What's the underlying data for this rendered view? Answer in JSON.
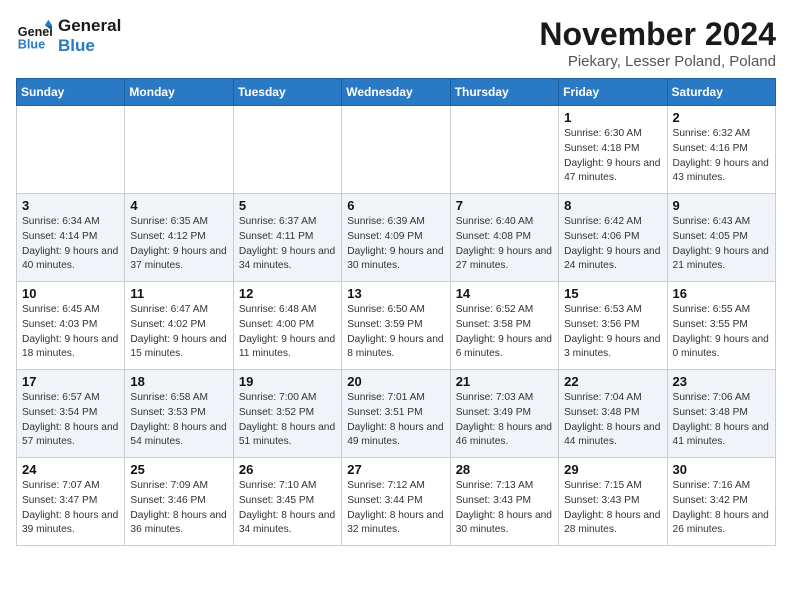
{
  "header": {
    "logo_line1": "General",
    "logo_line2": "Blue",
    "month": "November 2024",
    "location": "Piekary, Lesser Poland, Poland"
  },
  "weekdays": [
    "Sunday",
    "Monday",
    "Tuesday",
    "Wednesday",
    "Thursday",
    "Friday",
    "Saturday"
  ],
  "rows": [
    [
      {
        "day": "",
        "text": ""
      },
      {
        "day": "",
        "text": ""
      },
      {
        "day": "",
        "text": ""
      },
      {
        "day": "",
        "text": ""
      },
      {
        "day": "",
        "text": ""
      },
      {
        "day": "1",
        "text": "Sunrise: 6:30 AM\nSunset: 4:18 PM\nDaylight: 9 hours\nand 47 minutes."
      },
      {
        "day": "2",
        "text": "Sunrise: 6:32 AM\nSunset: 4:16 PM\nDaylight: 9 hours\nand 43 minutes."
      }
    ],
    [
      {
        "day": "3",
        "text": "Sunrise: 6:34 AM\nSunset: 4:14 PM\nDaylight: 9 hours\nand 40 minutes."
      },
      {
        "day": "4",
        "text": "Sunrise: 6:35 AM\nSunset: 4:12 PM\nDaylight: 9 hours\nand 37 minutes."
      },
      {
        "day": "5",
        "text": "Sunrise: 6:37 AM\nSunset: 4:11 PM\nDaylight: 9 hours\nand 34 minutes."
      },
      {
        "day": "6",
        "text": "Sunrise: 6:39 AM\nSunset: 4:09 PM\nDaylight: 9 hours\nand 30 minutes."
      },
      {
        "day": "7",
        "text": "Sunrise: 6:40 AM\nSunset: 4:08 PM\nDaylight: 9 hours\nand 27 minutes."
      },
      {
        "day": "8",
        "text": "Sunrise: 6:42 AM\nSunset: 4:06 PM\nDaylight: 9 hours\nand 24 minutes."
      },
      {
        "day": "9",
        "text": "Sunrise: 6:43 AM\nSunset: 4:05 PM\nDaylight: 9 hours\nand 21 minutes."
      }
    ],
    [
      {
        "day": "10",
        "text": "Sunrise: 6:45 AM\nSunset: 4:03 PM\nDaylight: 9 hours\nand 18 minutes."
      },
      {
        "day": "11",
        "text": "Sunrise: 6:47 AM\nSunset: 4:02 PM\nDaylight: 9 hours\nand 15 minutes."
      },
      {
        "day": "12",
        "text": "Sunrise: 6:48 AM\nSunset: 4:00 PM\nDaylight: 9 hours\nand 11 minutes."
      },
      {
        "day": "13",
        "text": "Sunrise: 6:50 AM\nSunset: 3:59 PM\nDaylight: 9 hours\nand 8 minutes."
      },
      {
        "day": "14",
        "text": "Sunrise: 6:52 AM\nSunset: 3:58 PM\nDaylight: 9 hours\nand 6 minutes."
      },
      {
        "day": "15",
        "text": "Sunrise: 6:53 AM\nSunset: 3:56 PM\nDaylight: 9 hours\nand 3 minutes."
      },
      {
        "day": "16",
        "text": "Sunrise: 6:55 AM\nSunset: 3:55 PM\nDaylight: 9 hours\nand 0 minutes."
      }
    ],
    [
      {
        "day": "17",
        "text": "Sunrise: 6:57 AM\nSunset: 3:54 PM\nDaylight: 8 hours\nand 57 minutes."
      },
      {
        "day": "18",
        "text": "Sunrise: 6:58 AM\nSunset: 3:53 PM\nDaylight: 8 hours\nand 54 minutes."
      },
      {
        "day": "19",
        "text": "Sunrise: 7:00 AM\nSunset: 3:52 PM\nDaylight: 8 hours\nand 51 minutes."
      },
      {
        "day": "20",
        "text": "Sunrise: 7:01 AM\nSunset: 3:51 PM\nDaylight: 8 hours\nand 49 minutes."
      },
      {
        "day": "21",
        "text": "Sunrise: 7:03 AM\nSunset: 3:49 PM\nDaylight: 8 hours\nand 46 minutes."
      },
      {
        "day": "22",
        "text": "Sunrise: 7:04 AM\nSunset: 3:48 PM\nDaylight: 8 hours\nand 44 minutes."
      },
      {
        "day": "23",
        "text": "Sunrise: 7:06 AM\nSunset: 3:48 PM\nDaylight: 8 hours\nand 41 minutes."
      }
    ],
    [
      {
        "day": "24",
        "text": "Sunrise: 7:07 AM\nSunset: 3:47 PM\nDaylight: 8 hours\nand 39 minutes."
      },
      {
        "day": "25",
        "text": "Sunrise: 7:09 AM\nSunset: 3:46 PM\nDaylight: 8 hours\nand 36 minutes."
      },
      {
        "day": "26",
        "text": "Sunrise: 7:10 AM\nSunset: 3:45 PM\nDaylight: 8 hours\nand 34 minutes."
      },
      {
        "day": "27",
        "text": "Sunrise: 7:12 AM\nSunset: 3:44 PM\nDaylight: 8 hours\nand 32 minutes."
      },
      {
        "day": "28",
        "text": "Sunrise: 7:13 AM\nSunset: 3:43 PM\nDaylight: 8 hours\nand 30 minutes."
      },
      {
        "day": "29",
        "text": "Sunrise: 7:15 AM\nSunset: 3:43 PM\nDaylight: 8 hours\nand 28 minutes."
      },
      {
        "day": "30",
        "text": "Sunrise: 7:16 AM\nSunset: 3:42 PM\nDaylight: 8 hours\nand 26 minutes."
      }
    ]
  ]
}
